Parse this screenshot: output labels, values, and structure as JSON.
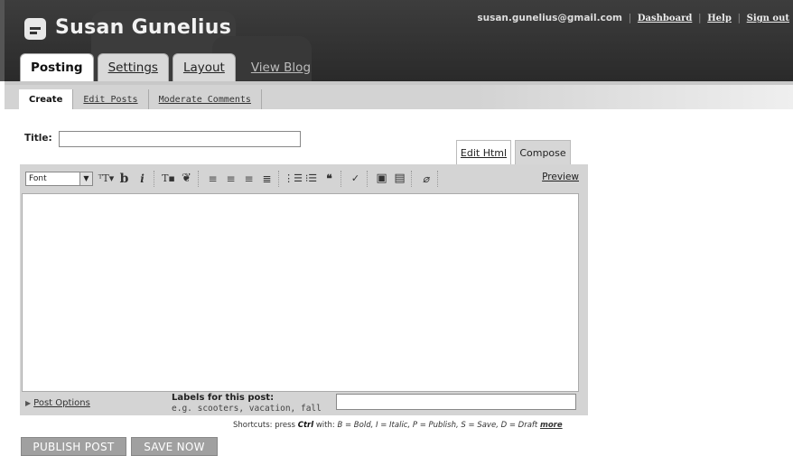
{
  "blog": {
    "title": "Susan Gunelius"
  },
  "user": {
    "email": "susan.gunelius@gmail.com",
    "links": [
      "Dashboard",
      "Help",
      "Sign out"
    ]
  },
  "main_tabs": [
    "Posting",
    "Settings",
    "Layout",
    "View Blog"
  ],
  "sub_tabs": [
    "Create",
    "Edit Posts",
    "Moderate Comments"
  ],
  "post": {
    "title_label": "Title:",
    "title_value": ""
  },
  "editor": {
    "mode_tabs": [
      "Edit Html",
      "Compose"
    ],
    "active_mode": "Compose",
    "font_select": "Font",
    "preview_label": "Preview",
    "toolbar_icons": [
      "font-size-icon",
      "bold-icon",
      "italic-icon",
      "text-color-icon",
      "link-icon",
      "align-left-icon",
      "align-center-icon",
      "align-right-icon",
      "justify-icon",
      "numbered-list-icon",
      "bullet-list-icon",
      "blockquote-icon",
      "spellcheck-icon",
      "image-icon",
      "video-icon",
      "eraser-icon"
    ]
  },
  "post_options_label": "Post Options",
  "labels": {
    "title": "Labels for this post:",
    "hint": "e.g. scooters, vacation, fall",
    "value": ""
  },
  "shortcuts": {
    "prefix": "Shortcuts: press",
    "key": "Ctrl",
    "with": "with:",
    "items": [
      "B = Bold,",
      "I = Italic,",
      "P = Publish,",
      "S = Save,",
      "D = Draft"
    ],
    "more": "more"
  },
  "buttons": {
    "publish": "PUBLISH POST",
    "save": "SAVE NOW"
  }
}
